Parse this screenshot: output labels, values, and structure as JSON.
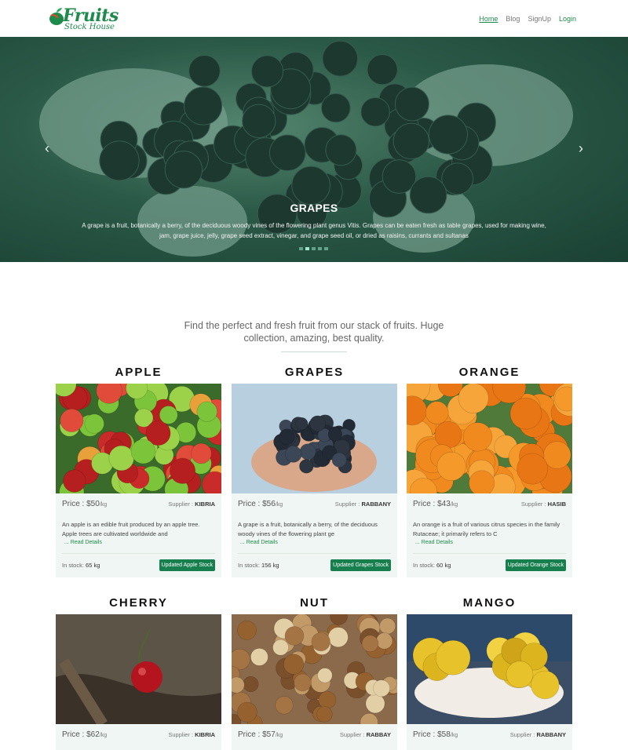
{
  "brand": {
    "name": "Fruits",
    "tagline": "Stock House"
  },
  "nav": {
    "home": "Home",
    "blog": "Blog",
    "signup": "SignUp",
    "login": "Login"
  },
  "hero": {
    "title": "GRAPES",
    "text": "A grape is a fruit, botanically a berry, of the deciduous woody vines of the flowering plant genus Vitis. Grapes can be eaten fresh as table grapes, used for making wine, jam, grape juice, jelly, grape seed extract, vinegar, and grape seed oil, or dried as raisins, currants and sultanas",
    "prev_icon": "chevron-left-icon",
    "next_icon": "chevron-right-icon",
    "prev_glyph": "‹",
    "next_glyph": "›",
    "slide_count": 5,
    "active_slide": 2
  },
  "intro": {
    "text": "Find the perfect and fresh fruit from our stack of fruits. Huge collection, amazing, best quality."
  },
  "labels": {
    "price_prefix": "Price : ",
    "unit": "/kg",
    "supplier_prefix": "Supplier : ",
    "in_stock_prefix": "In stock: ",
    "read_details": "... Read Details"
  },
  "products": [
    {
      "name": "APPLE",
      "price": "$50",
      "supplier": "KIBRIA",
      "desc": "An apple is an edible fruit produced by an apple tree. Apple trees are cultivated worldwide and",
      "stock": "65 kg",
      "button": "Updated Apple Stock"
    },
    {
      "name": "GRAPES",
      "price": "$56",
      "supplier": "RABBANY",
      "desc": "A grape is a fruit, botanically a berry, of the deciduous woody vines of the flowering plant ge",
      "stock": "156 kg",
      "button": "Updated Grapes Stock"
    },
    {
      "name": "ORANGE",
      "price": "$43",
      "supplier": "HASIB",
      "desc": "An orange is a fruit of various citrus species in the family Rutaceae; it primarily refers to C",
      "stock": "60 kg",
      "button": "Updated Orange Stock"
    },
    {
      "name": "CHERRY",
      "price": "$62",
      "supplier": "KIBRIA"
    },
    {
      "name": "NUT",
      "price": "$57",
      "supplier": "RABBAY"
    },
    {
      "name": "MANGO",
      "price": "$58",
      "supplier": "RABBANY"
    }
  ],
  "colors": {
    "brand_green": "#1e8a4c",
    "button_green": "#177e4d",
    "card_bg": "#f0f6f3"
  }
}
